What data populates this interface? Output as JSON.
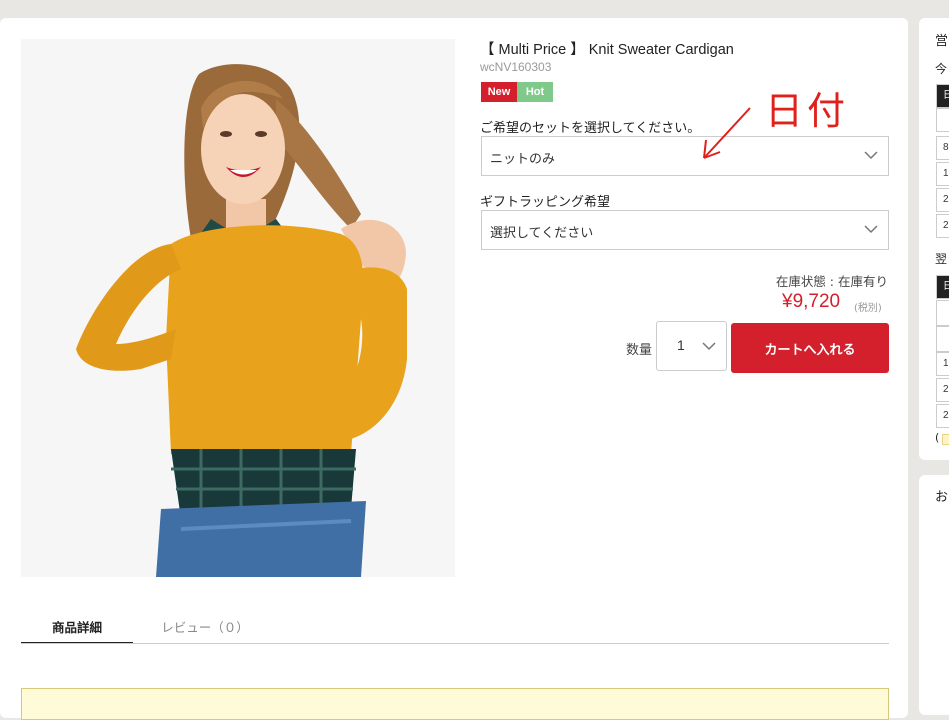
{
  "product": {
    "title": "【 Multi Price 】 Knit Sweater Cardigan",
    "sku": "wcNV160303",
    "badges": {
      "new": "New",
      "hot": "Hot"
    },
    "set_label": "ご希望のセットを選択してください。",
    "set_value": "ニットのみ",
    "gift_label": "ギフトラッピング希望",
    "gift_value": "選択してください",
    "stock": "在庫状態 : 在庫有り",
    "price": "¥9,720",
    "tax_note": "(税別)",
    "qty_label": "数量",
    "qty_value": "1",
    "cart_button": "カートへ入れる"
  },
  "annotation": {
    "text": "日付"
  },
  "tabs": [
    {
      "label": "商品詳細"
    },
    {
      "label": "レビュー（０）"
    }
  ],
  "sidebar": {
    "title_fragment": "営",
    "today_fragment": "今",
    "tomorrow_fragment": "翌",
    "other_fragment": "お",
    "paren_fragment": "(",
    "calendar_today": [
      "日",
      "",
      "8",
      "1",
      "2",
      "2"
    ],
    "calendar_tomorrow": [
      "日",
      "",
      "",
      "1",
      "2",
      "2"
    ]
  },
  "colors": {
    "accent_red": "#d3202c",
    "hot_green": "#7fc98a",
    "sweater": "#e9a21c",
    "notice_bg": "#fffbd9"
  },
  "icons": [
    "chevron-down-icon",
    "hand-drawn-arrow"
  ]
}
